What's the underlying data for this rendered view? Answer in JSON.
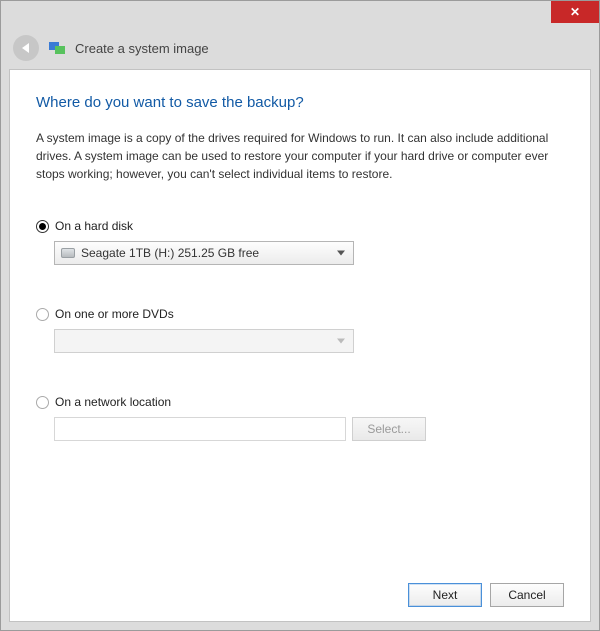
{
  "window": {
    "title": "Create a system image"
  },
  "heading": "Where do you want to save the backup?",
  "description": "A system image is a copy of the drives required for Windows to run. It can also include additional drives. A system image can be used to restore your computer if your hard drive or computer ever stops working; however, you can't select individual items to restore.",
  "options": {
    "hard_disk": {
      "label": "On a hard disk",
      "selected_drive": "Seagate 1TB (H:)  251.25 GB free",
      "checked": true
    },
    "dvd": {
      "label": "On one or more DVDs",
      "selected_drive": "",
      "checked": false,
      "enabled": false
    },
    "network": {
      "label": "On a network location",
      "path": "",
      "select_button": "Select...",
      "checked": false,
      "enabled": false
    }
  },
  "footer": {
    "next": "Next",
    "cancel": "Cancel"
  }
}
